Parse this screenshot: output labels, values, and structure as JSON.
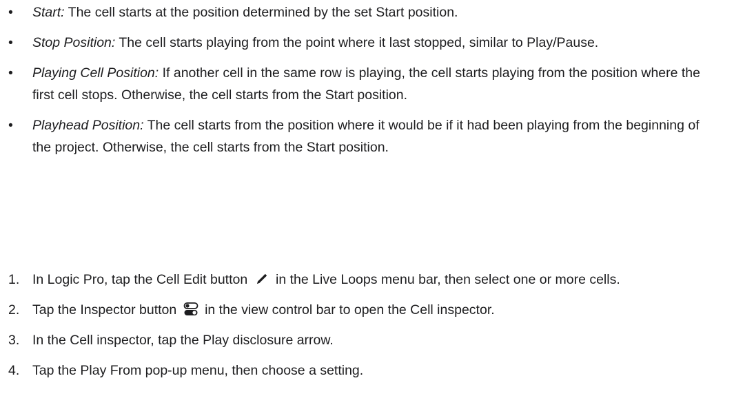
{
  "options": [
    {
      "term": "Start:",
      "text": " The cell starts at the position determined by the set Start position."
    },
    {
      "term": "Stop Position:",
      "text": " The cell starts playing from the point where it last stopped, similar to Play/Pause."
    },
    {
      "term": "Playing Cell Position:",
      "text": " If another cell in the same row is playing, the cell starts playing from the position where the first cell stops. Otherwise, the cell starts from the Start position."
    },
    {
      "term": "Playhead Position:",
      "text": " The cell starts from the position where it would be if it had been playing from the beginning of the project. Otherwise, the cell starts from the Start position."
    }
  ],
  "bullet": "•",
  "steps": [
    {
      "num": "1.",
      "before": "In Logic Pro, tap the Cell Edit button",
      "icon": "pencil-icon",
      "after": "in the Live Loops menu bar, then select one or more cells."
    },
    {
      "num": "2.",
      "before": "Tap the Inspector button",
      "icon": "inspector-toggle-icon",
      "after": "in the view control bar to open the Cell inspector."
    },
    {
      "num": "3.",
      "text": "In the Cell inspector, tap the Play disclosure arrow."
    },
    {
      "num": "4.",
      "text": "Tap the Play From pop-up menu, then choose a setting."
    }
  ]
}
